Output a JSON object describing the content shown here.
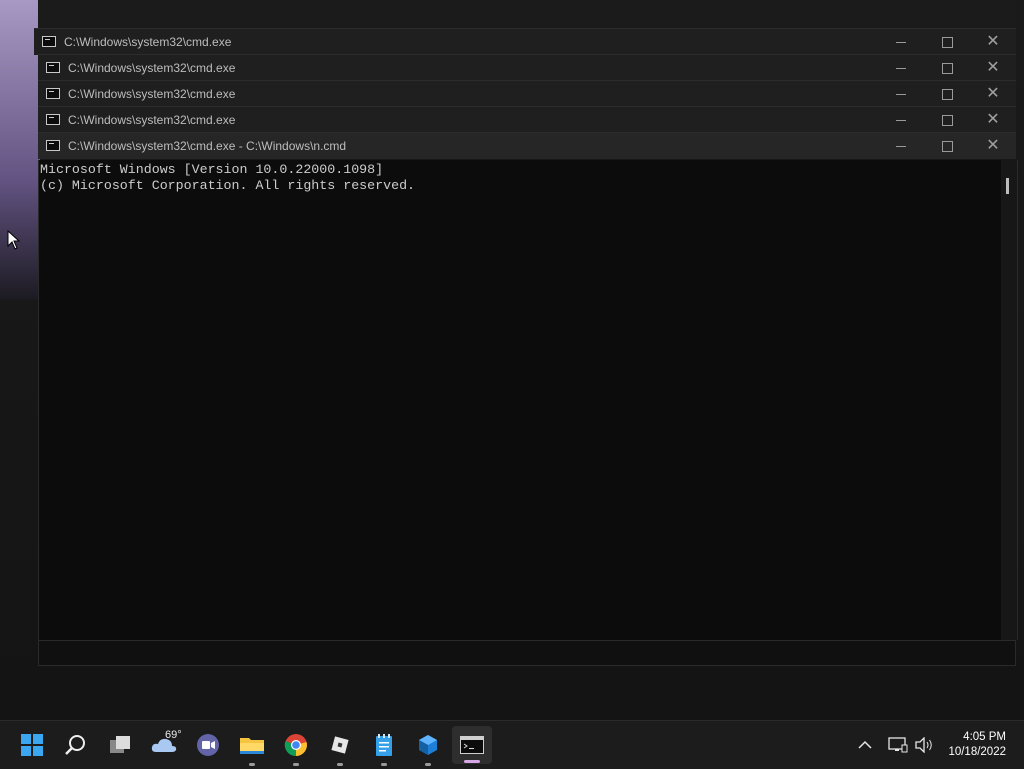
{
  "windows": [
    {
      "title": "C:\\Windows\\system32\\cmd.exe"
    },
    {
      "title": "C:\\Windows\\system32\\cmd.exe"
    },
    {
      "title": "C:\\Windows\\system32\\cmd.exe"
    },
    {
      "title": "C:\\Windows\\system32\\cmd.exe"
    },
    {
      "title": "C:\\Windows\\system32\\cmd.exe - C:\\Windows\\n.cmd"
    }
  ],
  "console": {
    "line1": "Microsoft Windows [Version 10.0.22000.1098]",
    "line2": "(c) Microsoft Corporation. All rights reserved."
  },
  "taskbar": {
    "weather_temp": "69°",
    "time": "4:05 PM",
    "date": "10/18/2022",
    "icons": [
      "windows-start-icon",
      "search-icon",
      "task-view-icon",
      "weather-icon",
      "teams-chat-icon",
      "file-explorer-icon",
      "chrome-icon",
      "roblox-icon",
      "notepad-icon",
      "app-cube-icon",
      "terminal-icon"
    ]
  },
  "colors": {
    "console_bg": "#0c0c0c",
    "console_text": "#cccccc",
    "taskbar_bg": "#1c1c1c",
    "active_indicator": "#d6a6e6"
  }
}
